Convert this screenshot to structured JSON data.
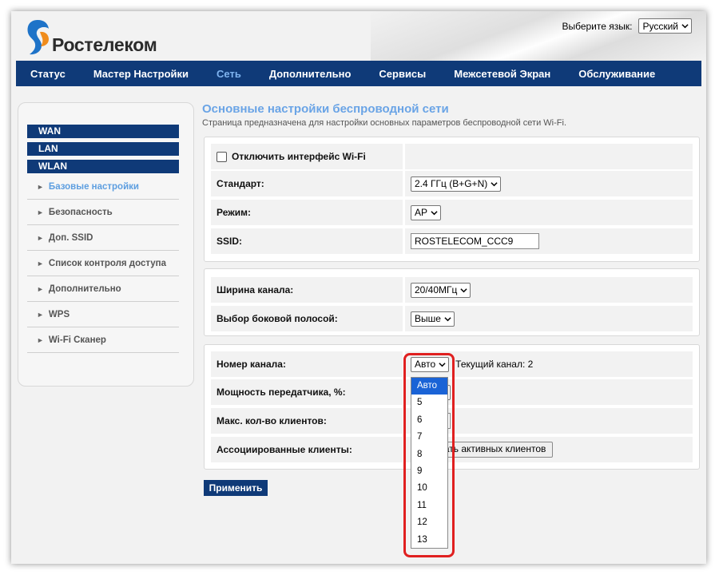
{
  "header": {
    "logo_text": "Ростелеком",
    "language_label": "Выберите язык:",
    "language_value": "Русский"
  },
  "nav": [
    {
      "label": "Статус",
      "active": false
    },
    {
      "label": "Мастер Настройки",
      "active": false
    },
    {
      "label": "Сеть",
      "active": true
    },
    {
      "label": "Дополнительно",
      "active": false
    },
    {
      "label": "Сервисы",
      "active": false
    },
    {
      "label": "Межсетевой Экран",
      "active": false
    },
    {
      "label": "Обслуживание",
      "active": false
    }
  ],
  "sidebar": {
    "groups": [
      "WAN",
      "LAN",
      "WLAN"
    ],
    "items": [
      {
        "label": "Базовые настройки",
        "active": true
      },
      {
        "label": "Безопасность",
        "active": false
      },
      {
        "label": "Доп. SSID",
        "active": false
      },
      {
        "label": "Список контроля доступа",
        "active": false
      },
      {
        "label": "Дополнительно",
        "active": false
      },
      {
        "label": "WPS",
        "active": false
      },
      {
        "label": "Wi-Fi Сканер",
        "active": false
      }
    ]
  },
  "page": {
    "title": "Основные настройки беспроводной сети",
    "description": "Страница предназначена для настройки основных параметров беспроводной сети Wi-Fi."
  },
  "basic": {
    "disable_label": "Отключить интерфейс Wi-Fi",
    "disable_checked": false,
    "standard_label": "Стандарт:",
    "standard_value": "2.4 ГГц (B+G+N)",
    "mode_label": "Режим:",
    "mode_value": "AP",
    "ssid_label": "SSID:",
    "ssid_value": "ROSTELECOM_CCC9"
  },
  "channel_width": {
    "width_label": "Ширина канала:",
    "width_value": "20/40МГц",
    "sideband_label": "Выбор боковой полосой:",
    "sideband_value": "Выше"
  },
  "channel": {
    "channel_label": "Номер канала:",
    "channel_value": "Авто",
    "current_label": "Текущий канал: 2",
    "power_label": "Мощность передатчика, %:",
    "max_clients_label": "Макс. кол-во клиентов:",
    "assoc_label": "Ассоциированные клиенты:",
    "show_button": "Показать активных клиентов",
    "dropdown_options": [
      "Авто",
      "5",
      "6",
      "7",
      "8",
      "9",
      "10",
      "11",
      "12",
      "13"
    ],
    "selected_option": "Авто"
  },
  "apply_label": "Применить",
  "colors": {
    "nav_bg": "#0f3a78",
    "accent": "#6aa4e6",
    "highlight": "#e02020",
    "selected_option": "#1a63d6"
  }
}
